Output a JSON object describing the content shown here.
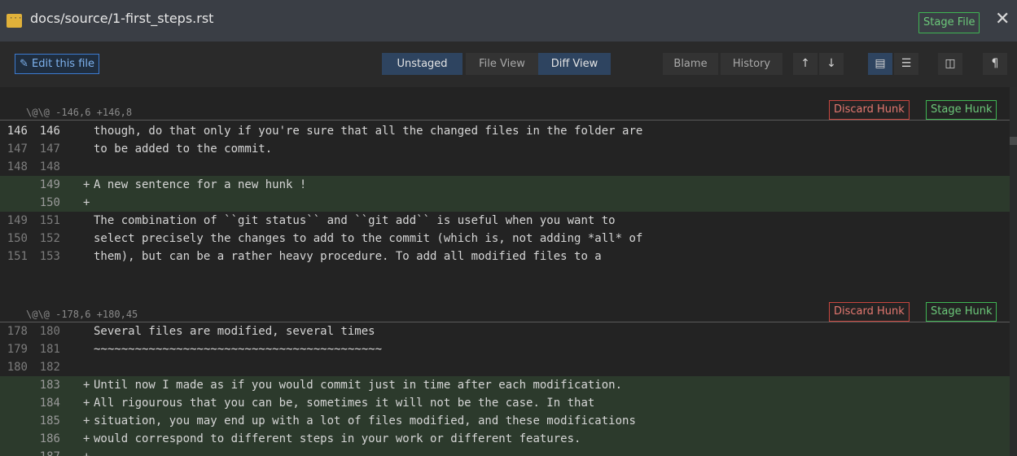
{
  "title": "docs/source/1-first_steps.rst",
  "titlebar": {
    "stage_file": "Stage File",
    "close": "✕",
    "file_icon": "···"
  },
  "toolbar": {
    "edit": "Edit this file",
    "unstaged": "Unstaged",
    "file_view": "File View",
    "diff_view": "Diff View",
    "blame": "Blame",
    "history": "History",
    "icons": {
      "up": "↑",
      "down": "↓",
      "list": "▤",
      "bullets": "☰",
      "columns": "◫",
      "pilcrow": "¶"
    }
  },
  "hunks": [
    {
      "header": "\\@\\@ -146,6 +146,8",
      "discard": "Discard Hunk",
      "stage": "Stage Hunk",
      "lines": [
        {
          "old": "146",
          "new": "146",
          "type": "context",
          "text": "though, do that only if you're sure that all the changed files in the folder are"
        },
        {
          "old": "147",
          "new": "147",
          "type": "context",
          "text": "to be added to the commit."
        },
        {
          "old": "148",
          "new": "148",
          "type": "context",
          "text": ""
        },
        {
          "old": "",
          "new": "149",
          "type": "added",
          "text": "A new sentence for a new hunk !"
        },
        {
          "old": "",
          "new": "150",
          "type": "added",
          "text": ""
        },
        {
          "old": "149",
          "new": "151",
          "type": "context",
          "text": "The combination of ``git status`` and ``git add`` is useful when you want to"
        },
        {
          "old": "150",
          "new": "152",
          "type": "context",
          "text": "select precisely the changes to add to the commit (which is, not adding *all* of"
        },
        {
          "old": "151",
          "new": "153",
          "type": "context",
          "text": "them), but can be a rather heavy procedure. To add all modified files to a"
        }
      ]
    },
    {
      "header": "\\@\\@ -178,6 +180,45",
      "discard": "Discard Hunk",
      "stage": "Stage Hunk",
      "lines": [
        {
          "old": "178",
          "new": "180",
          "type": "context",
          "text": "Several files are modified, several times"
        },
        {
          "old": "179",
          "new": "181",
          "type": "context",
          "text": "~~~~~~~~~~~~~~~~~~~~~~~~~~~~~~~~~~~~~~~~~~"
        },
        {
          "old": "180",
          "new": "182",
          "type": "context",
          "text": ""
        },
        {
          "old": "",
          "new": "183",
          "type": "added",
          "text": "Until now I made as if you would commit just in time after each modification."
        },
        {
          "old": "",
          "new": "184",
          "type": "added",
          "text": "All rigourous that you can be, sometimes it will not be the case. In that"
        },
        {
          "old": "",
          "new": "185",
          "type": "added",
          "text": "situation, you may end up with a lot of files modified, and these modifications"
        },
        {
          "old": "",
          "new": "186",
          "type": "added",
          "text": "would correspond to different steps in your work or different features."
        },
        {
          "old": "",
          "new": "187",
          "type": "added",
          "text": ""
        }
      ]
    }
  ]
}
